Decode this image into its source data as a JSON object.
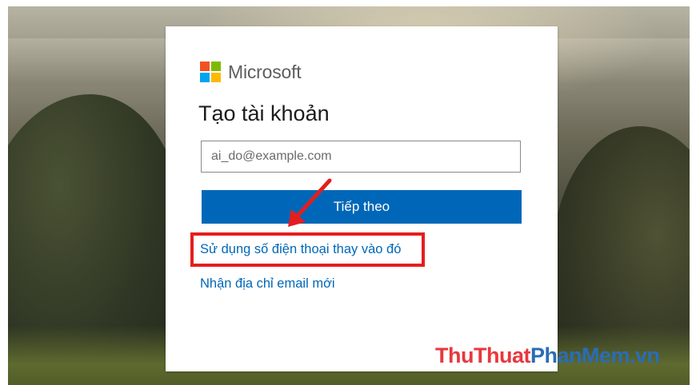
{
  "brand": {
    "name": "Microsoft",
    "logo_colors": [
      "#f25022",
      "#7fba00",
      "#00a4ef",
      "#ffb900"
    ]
  },
  "signup": {
    "title": "Tạo tài khoản",
    "email_placeholder": "ai_do@example.com",
    "email_value": "",
    "next_button": "Tiếp theo",
    "use_phone_link": "Sử dụng số điện thoại thay vào đó",
    "new_email_link": "Nhận địa chỉ email mới"
  },
  "colors": {
    "accent": "#0067b8",
    "link": "#0067b8",
    "annotation": "#e41e1e"
  },
  "watermark": {
    "part1": "ThuThuat",
    "part2": "PhanMem.vn"
  }
}
